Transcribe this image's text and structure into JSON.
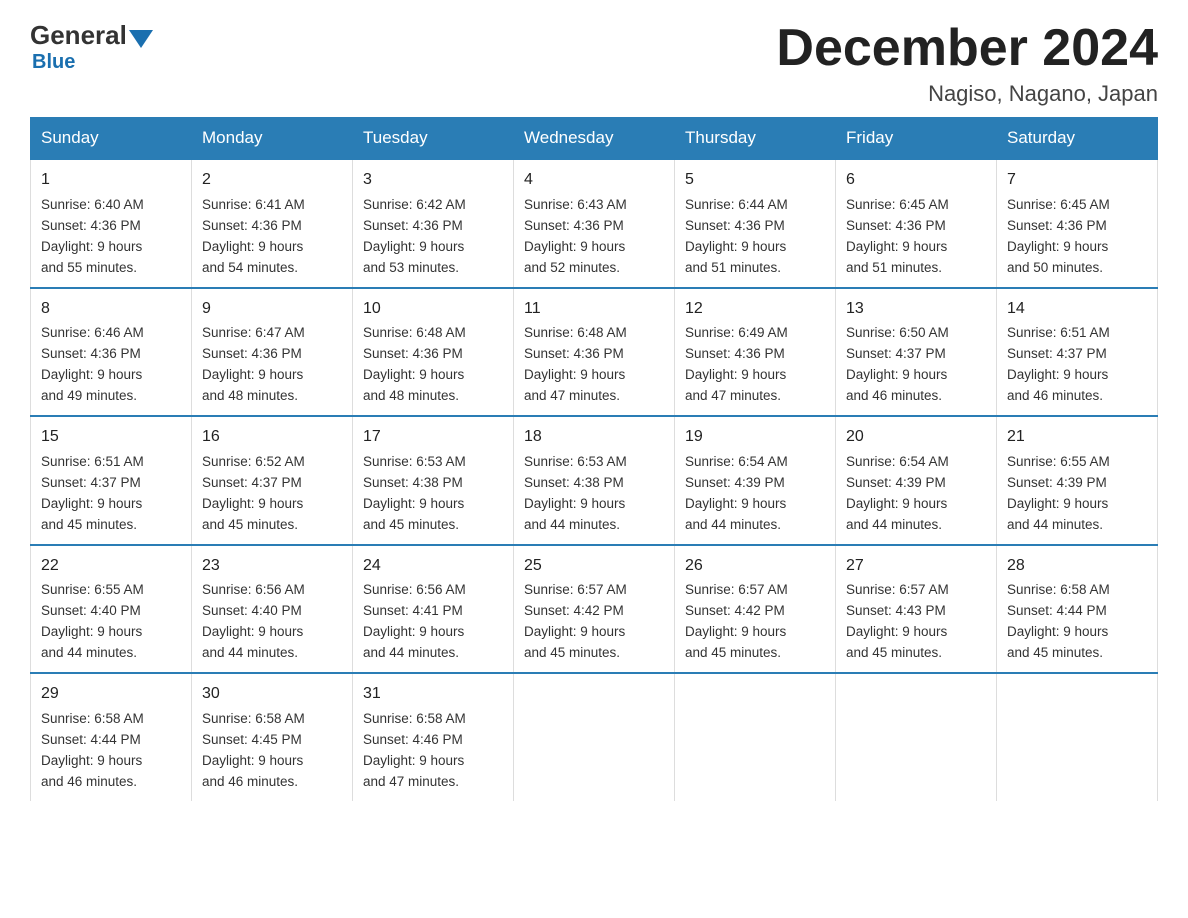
{
  "header": {
    "logo_general": "General",
    "logo_blue": "Blue",
    "title": "December 2024",
    "subtitle": "Nagiso, Nagano, Japan"
  },
  "days_of_week": [
    "Sunday",
    "Monday",
    "Tuesday",
    "Wednesday",
    "Thursday",
    "Friday",
    "Saturday"
  ],
  "weeks": [
    [
      {
        "day": "1",
        "sunrise": "6:40 AM",
        "sunset": "4:36 PM",
        "daylight": "9 hours and 55 minutes."
      },
      {
        "day": "2",
        "sunrise": "6:41 AM",
        "sunset": "4:36 PM",
        "daylight": "9 hours and 54 minutes."
      },
      {
        "day": "3",
        "sunrise": "6:42 AM",
        "sunset": "4:36 PM",
        "daylight": "9 hours and 53 minutes."
      },
      {
        "day": "4",
        "sunrise": "6:43 AM",
        "sunset": "4:36 PM",
        "daylight": "9 hours and 52 minutes."
      },
      {
        "day": "5",
        "sunrise": "6:44 AM",
        "sunset": "4:36 PM",
        "daylight": "9 hours and 51 minutes."
      },
      {
        "day": "6",
        "sunrise": "6:45 AM",
        "sunset": "4:36 PM",
        "daylight": "9 hours and 51 minutes."
      },
      {
        "day": "7",
        "sunrise": "6:45 AM",
        "sunset": "4:36 PM",
        "daylight": "9 hours and 50 minutes."
      }
    ],
    [
      {
        "day": "8",
        "sunrise": "6:46 AM",
        "sunset": "4:36 PM",
        "daylight": "9 hours and 49 minutes."
      },
      {
        "day": "9",
        "sunrise": "6:47 AM",
        "sunset": "4:36 PM",
        "daylight": "9 hours and 48 minutes."
      },
      {
        "day": "10",
        "sunrise": "6:48 AM",
        "sunset": "4:36 PM",
        "daylight": "9 hours and 48 minutes."
      },
      {
        "day": "11",
        "sunrise": "6:48 AM",
        "sunset": "4:36 PM",
        "daylight": "9 hours and 47 minutes."
      },
      {
        "day": "12",
        "sunrise": "6:49 AM",
        "sunset": "4:36 PM",
        "daylight": "9 hours and 47 minutes."
      },
      {
        "day": "13",
        "sunrise": "6:50 AM",
        "sunset": "4:37 PM",
        "daylight": "9 hours and 46 minutes."
      },
      {
        "day": "14",
        "sunrise": "6:51 AM",
        "sunset": "4:37 PM",
        "daylight": "9 hours and 46 minutes."
      }
    ],
    [
      {
        "day": "15",
        "sunrise": "6:51 AM",
        "sunset": "4:37 PM",
        "daylight": "9 hours and 45 minutes."
      },
      {
        "day": "16",
        "sunrise": "6:52 AM",
        "sunset": "4:37 PM",
        "daylight": "9 hours and 45 minutes."
      },
      {
        "day": "17",
        "sunrise": "6:53 AM",
        "sunset": "4:38 PM",
        "daylight": "9 hours and 45 minutes."
      },
      {
        "day": "18",
        "sunrise": "6:53 AM",
        "sunset": "4:38 PM",
        "daylight": "9 hours and 44 minutes."
      },
      {
        "day": "19",
        "sunrise": "6:54 AM",
        "sunset": "4:39 PM",
        "daylight": "9 hours and 44 minutes."
      },
      {
        "day": "20",
        "sunrise": "6:54 AM",
        "sunset": "4:39 PM",
        "daylight": "9 hours and 44 minutes."
      },
      {
        "day": "21",
        "sunrise": "6:55 AM",
        "sunset": "4:39 PM",
        "daylight": "9 hours and 44 minutes."
      }
    ],
    [
      {
        "day": "22",
        "sunrise": "6:55 AM",
        "sunset": "4:40 PM",
        "daylight": "9 hours and 44 minutes."
      },
      {
        "day": "23",
        "sunrise": "6:56 AM",
        "sunset": "4:40 PM",
        "daylight": "9 hours and 44 minutes."
      },
      {
        "day": "24",
        "sunrise": "6:56 AM",
        "sunset": "4:41 PM",
        "daylight": "9 hours and 44 minutes."
      },
      {
        "day": "25",
        "sunrise": "6:57 AM",
        "sunset": "4:42 PM",
        "daylight": "9 hours and 45 minutes."
      },
      {
        "day": "26",
        "sunrise": "6:57 AM",
        "sunset": "4:42 PM",
        "daylight": "9 hours and 45 minutes."
      },
      {
        "day": "27",
        "sunrise": "6:57 AM",
        "sunset": "4:43 PM",
        "daylight": "9 hours and 45 minutes."
      },
      {
        "day": "28",
        "sunrise": "6:58 AM",
        "sunset": "4:44 PM",
        "daylight": "9 hours and 45 minutes."
      }
    ],
    [
      {
        "day": "29",
        "sunrise": "6:58 AM",
        "sunset": "4:44 PM",
        "daylight": "9 hours and 46 minutes."
      },
      {
        "day": "30",
        "sunrise": "6:58 AM",
        "sunset": "4:45 PM",
        "daylight": "9 hours and 46 minutes."
      },
      {
        "day": "31",
        "sunrise": "6:58 AM",
        "sunset": "4:46 PM",
        "daylight": "9 hours and 47 minutes."
      },
      null,
      null,
      null,
      null
    ]
  ],
  "labels": {
    "sunrise": "Sunrise:",
    "sunset": "Sunset:",
    "daylight": "Daylight:"
  }
}
